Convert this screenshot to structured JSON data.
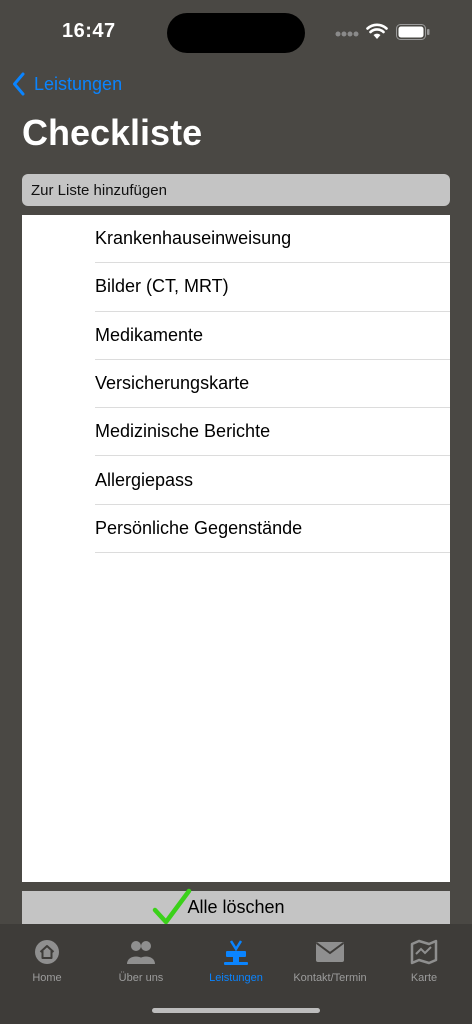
{
  "status_bar": {
    "time": "16:47"
  },
  "nav": {
    "back_label": "Leistungen",
    "title": "Checkliste"
  },
  "add_field": {
    "placeholder": "Zur Liste hinzufügen"
  },
  "checklist": {
    "items": [
      "Krankenhauseinweisung",
      "Bilder (CT, MRT)",
      "Medikamente",
      "Versicherungskarte",
      "Medizinische Berichte",
      "Allergiepass",
      "Persönliche Gegenstände"
    ]
  },
  "clear_button": {
    "label": "Alle löschen"
  },
  "tab_bar": {
    "tabs": [
      {
        "label": "Home",
        "icon": "home-icon"
      },
      {
        "label": "Über uns",
        "icon": "people-icon"
      },
      {
        "label": "Leistungen",
        "icon": "services-icon",
        "active": true
      },
      {
        "label": "Kontakt/Termin",
        "icon": "mail-icon"
      },
      {
        "label": "Karte",
        "icon": "map-icon"
      }
    ]
  },
  "colors": {
    "accent": "#0a84ff",
    "background": "#4a4844",
    "check": "#3bd11a"
  }
}
